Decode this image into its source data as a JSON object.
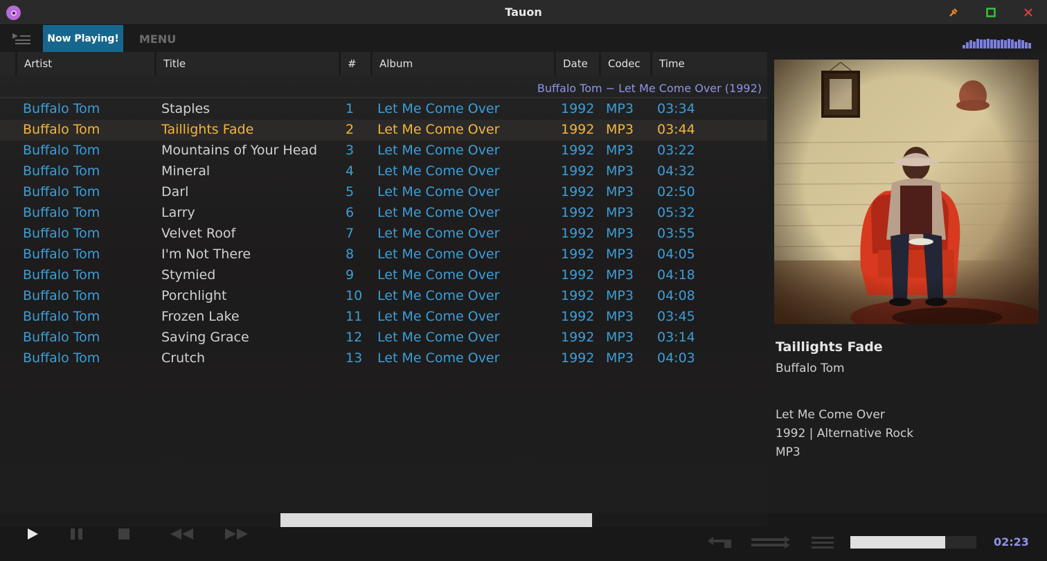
{
  "window": {
    "title": "Tauon"
  },
  "topbar": {
    "now_playing_tab": "Now Playing!",
    "menu_tab": "MENU"
  },
  "spectrum_levels": [
    0.2,
    0.35,
    0.45,
    0.4,
    0.55,
    0.5,
    0.5,
    0.55,
    0.5,
    0.5,
    0.45,
    0.5,
    0.45,
    0.55,
    0.5,
    0.4,
    0.5,
    0.45,
    0.35,
    0.3
  ],
  "columns": [
    "Artist",
    "Title",
    "#",
    "Album",
    "Date",
    "Codec",
    "Time"
  ],
  "album_group_title": "Buffalo Tom − Let Me Come Over (1992)",
  "tracks": [
    {
      "artist": "Buffalo Tom",
      "title": "Staples",
      "num": "1",
      "album": "Let Me Come Over",
      "date": "1992",
      "codec": "MP3",
      "time": "03:34"
    },
    {
      "artist": "Buffalo Tom",
      "title": "Taillights Fade",
      "num": "2",
      "album": "Let Me Come Over",
      "date": "1992",
      "codec": "MP3",
      "time": "03:44",
      "playing": true
    },
    {
      "artist": "Buffalo Tom",
      "title": "Mountains of Your Head",
      "num": "3",
      "album": "Let Me Come Over",
      "date": "1992",
      "codec": "MP3",
      "time": "03:22"
    },
    {
      "artist": "Buffalo Tom",
      "title": "Mineral",
      "num": "4",
      "album": "Let Me Come Over",
      "date": "1992",
      "codec": "MP3",
      "time": "04:32"
    },
    {
      "artist": "Buffalo Tom",
      "title": "Darl",
      "num": "5",
      "album": "Let Me Come Over",
      "date": "1992",
      "codec": "MP3",
      "time": "02:50"
    },
    {
      "artist": "Buffalo Tom",
      "title": "Larry",
      "num": "6",
      "album": "Let Me Come Over",
      "date": "1992",
      "codec": "MP3",
      "time": "05:32"
    },
    {
      "artist": "Buffalo Tom",
      "title": "Velvet Roof",
      "num": "7",
      "album": "Let Me Come Over",
      "date": "1992",
      "codec": "MP3",
      "time": "03:55"
    },
    {
      "artist": "Buffalo Tom",
      "title": "I'm Not There",
      "num": "8",
      "album": "Let Me Come Over",
      "date": "1992",
      "codec": "MP3",
      "time": "04:05"
    },
    {
      "artist": "Buffalo Tom",
      "title": "Stymied",
      "num": "9",
      "album": "Let Me Come Over",
      "date": "1992",
      "codec": "MP3",
      "time": "04:18"
    },
    {
      "artist": "Buffalo Tom",
      "title": "Porchlight",
      "num": "10",
      "album": "Let Me Come Over",
      "date": "1992",
      "codec": "MP3",
      "time": "04:08"
    },
    {
      "artist": "Buffalo Tom",
      "title": "Frozen Lake",
      "num": "11",
      "album": "Let Me Come Over",
      "date": "1992",
      "codec": "MP3",
      "time": "03:45"
    },
    {
      "artist": "Buffalo Tom",
      "title": "Saving Grace",
      "num": "12",
      "album": "Let Me Come Over",
      "date": "1992",
      "codec": "MP3",
      "time": "03:14"
    },
    {
      "artist": "Buffalo Tom",
      "title": "Crutch",
      "num": "13",
      "album": "Let Me Come Over",
      "date": "1992",
      "codec": "MP3",
      "time": "04:03"
    }
  ],
  "now_playing": {
    "title": "Taillights Fade",
    "artist": "Buffalo Tom",
    "album": "Let Me Come Over",
    "year_genre": "1992 | Alternative Rock",
    "codec": "MP3"
  },
  "playback": {
    "elapsed": "02:23",
    "progress": 0.64,
    "volume": 0.75
  },
  "colors": {
    "accent_blue": "#3b9fd9",
    "playing_gold": "#f5b73a",
    "tab_blue": "#16678e",
    "lavender": "#8f93e8"
  },
  "icons": {
    "app": "tauon-disc-icon",
    "minimize": "pin-icon",
    "maximize": "square-icon",
    "close": "x-icon",
    "play": "play-icon",
    "pause": "pause-icon",
    "stop": "stop-icon",
    "prev": "rewind-icon",
    "next": "fast-forward-icon",
    "repeat": "repeat-icon",
    "shuffle": "shuffle-icon",
    "queue": "menu-lines-icon"
  }
}
